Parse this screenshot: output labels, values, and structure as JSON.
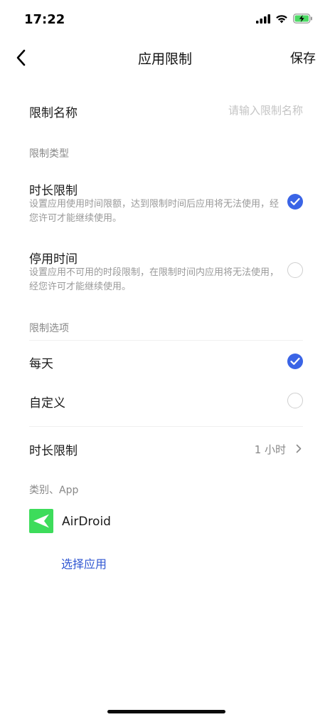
{
  "status_bar": {
    "time": "17:22",
    "icons": [
      "cellular-signal-icon",
      "wifi-icon",
      "battery-charging-icon"
    ]
  },
  "nav": {
    "title": "应用限制",
    "save_label": "保存",
    "back_icon": "chevron-left-icon"
  },
  "limit_name": {
    "label": "限制名称",
    "placeholder": "请输入限制名称",
    "value": ""
  },
  "limit_type": {
    "section_label": "限制类型",
    "options": [
      {
        "title": "时长限制",
        "description": "设置应用使用时间限额，达到限制时间后应用将无法使用，经您许可才能继续使用。",
        "selected": true
      },
      {
        "title": "停用时间",
        "description": "设置应用不可用的时段限制，在限制时间内应用将无法使用，经您许可才能继续使用。",
        "selected": false
      }
    ]
  },
  "limit_options": {
    "section_label": "限制选项",
    "options": [
      {
        "title": "每天",
        "selected": true
      },
      {
        "title": "自定义",
        "selected": false
      }
    ]
  },
  "duration": {
    "label": "时长限制",
    "value": "1 小时"
  },
  "apps": {
    "section_label": "类别、App",
    "items": [
      {
        "name": "AirDroid",
        "icon": "airdroid-app-icon"
      }
    ],
    "select_label": "选择应用"
  },
  "colors": {
    "accent": "#3a64e6",
    "link": "#2f56d2",
    "app_green": "#3ddc5b",
    "battery_green": "#4cd964"
  }
}
